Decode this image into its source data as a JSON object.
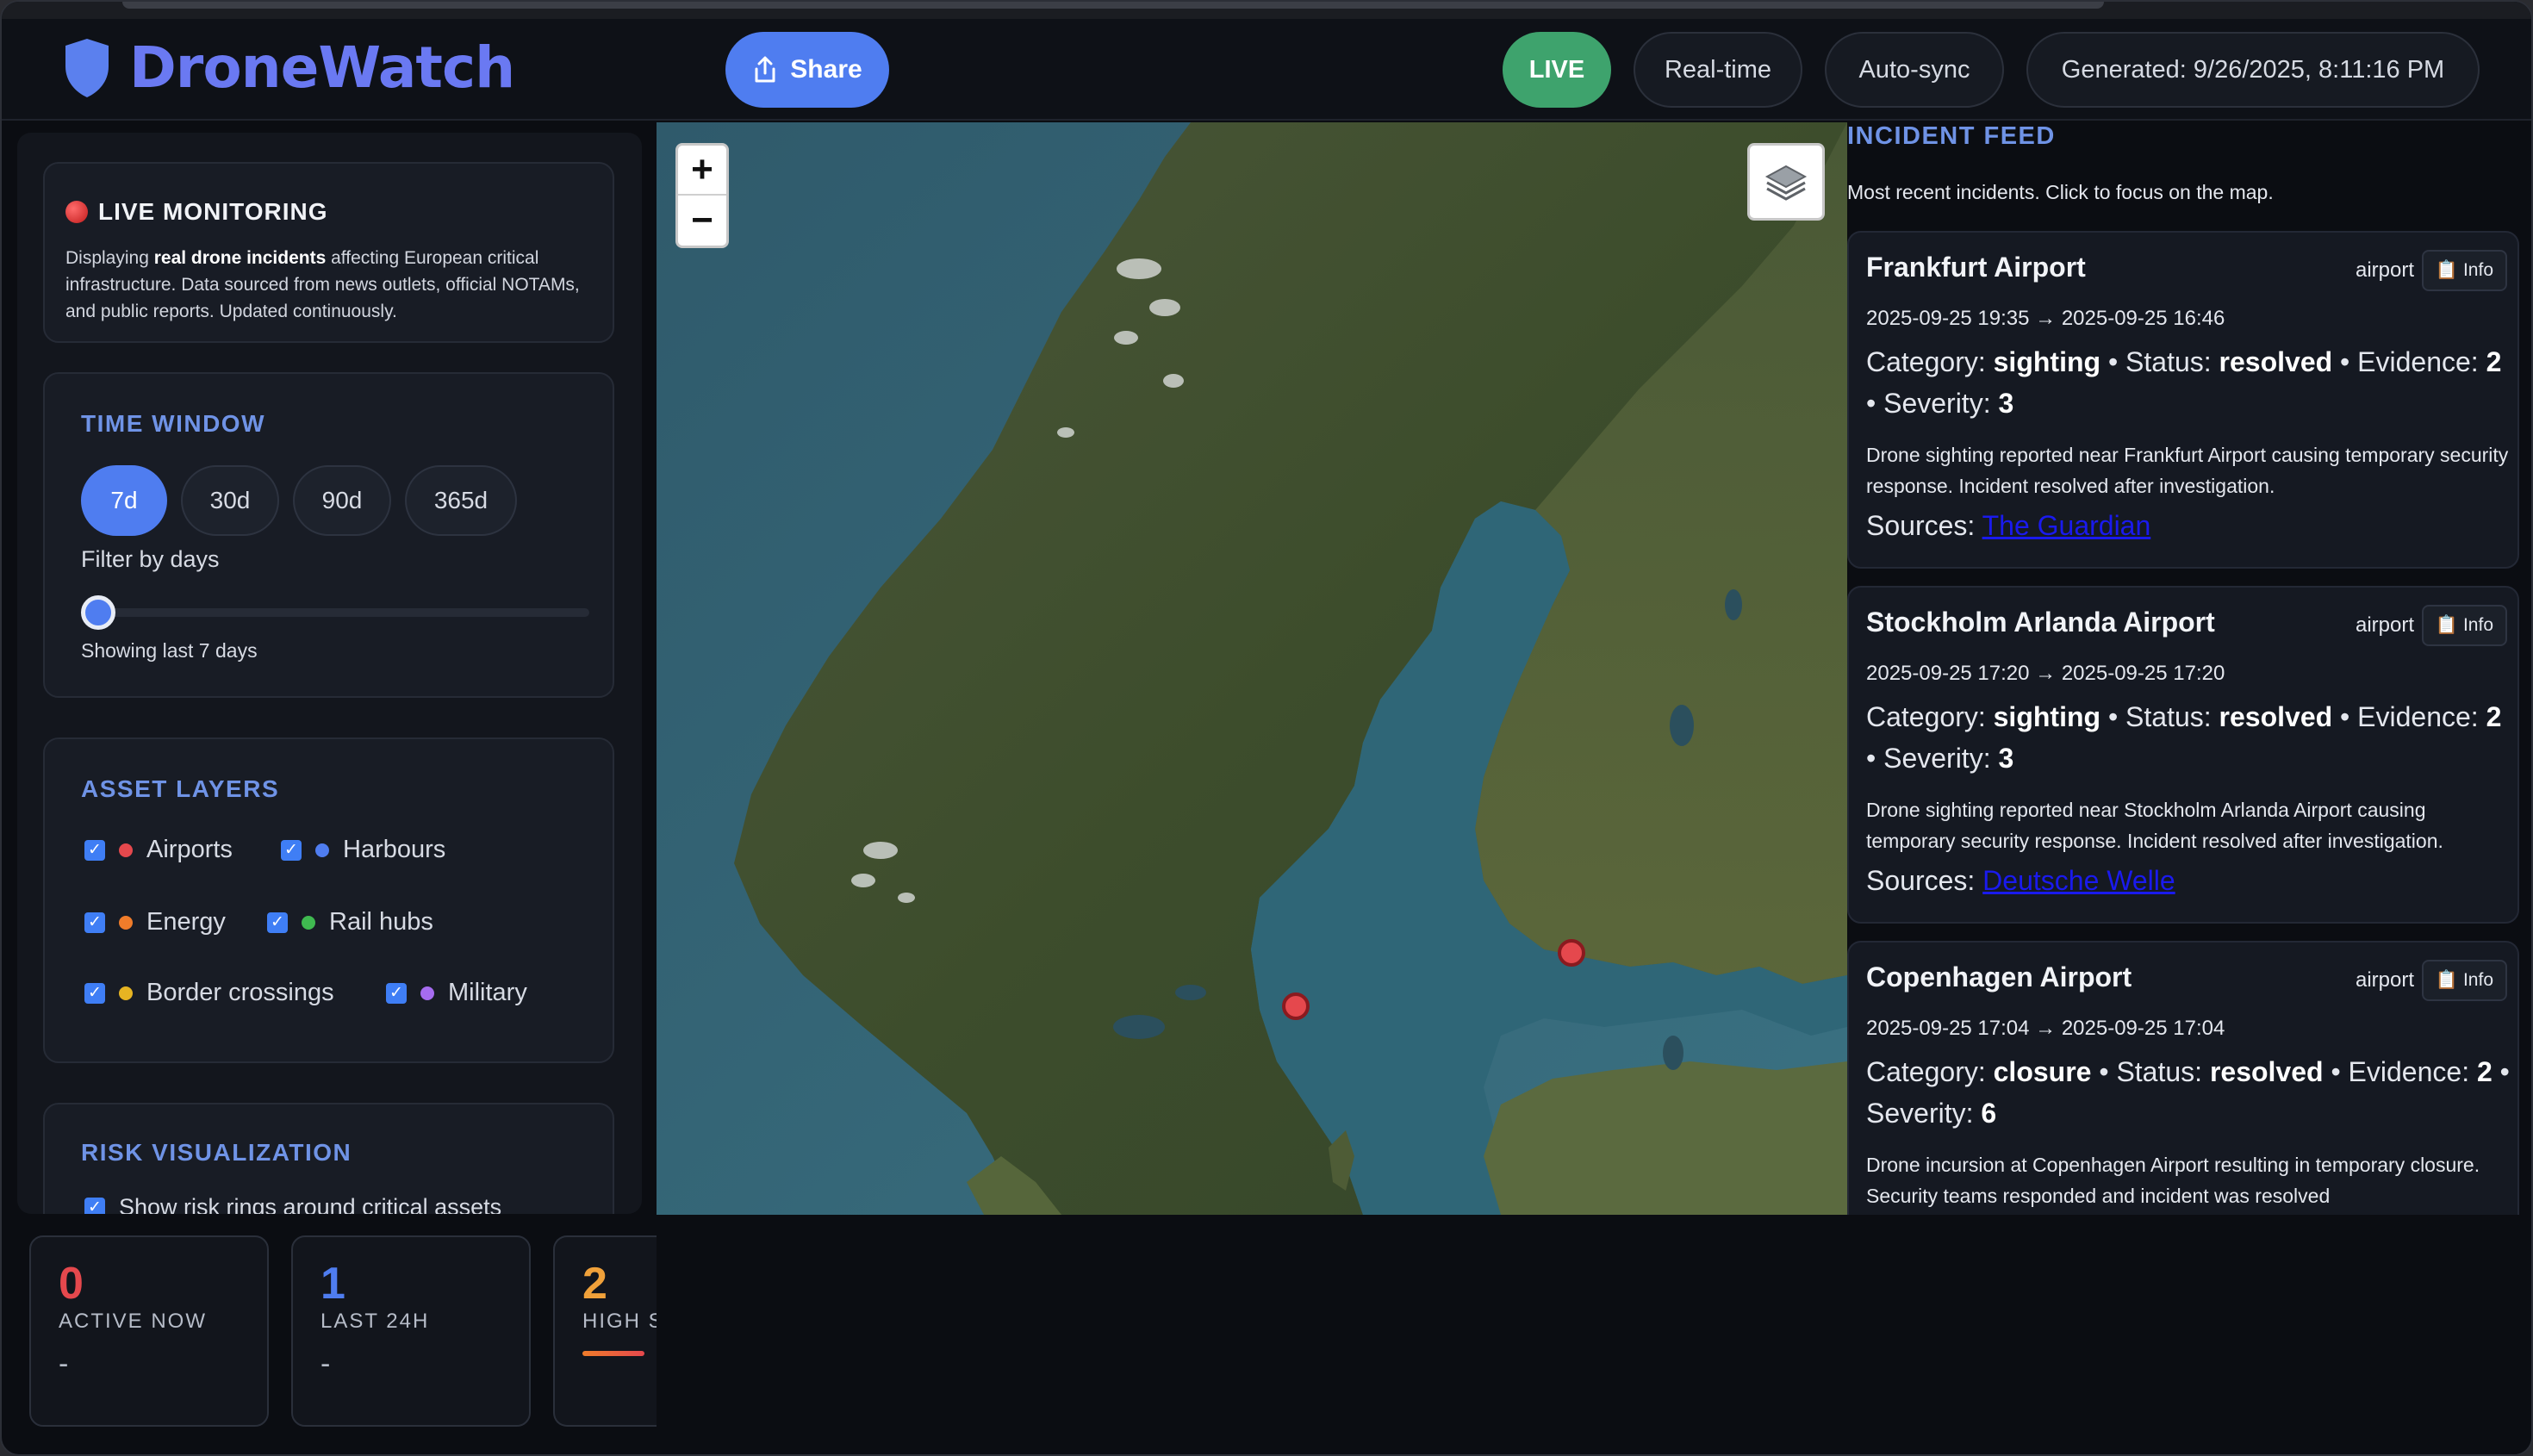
{
  "app": {
    "name": "DroneWatch"
  },
  "header": {
    "share_label": "Share",
    "live_label": "LIVE",
    "realtime_label": "Real-time",
    "autosync_label": "Auto-sync",
    "generated_label": "Generated: 9/26/2025, 8:11:16 PM"
  },
  "sidebar": {
    "live": {
      "title": "LIVE MONITORING",
      "desc_prefix": "Displaying ",
      "desc_bold": "real drone incidents",
      "desc_rest": " affecting European critical infrastructure. Data sourced from news outlets, official NOTAMs, and public reports. Updated continuously."
    },
    "time_window": {
      "title": "TIME WINDOW",
      "options": [
        "7d",
        "30d",
        "90d",
        "365d"
      ],
      "selected": "7d",
      "filter_label": "Filter by days",
      "slider_fraction": 0.0,
      "showing_text": "Showing last 7 days"
    },
    "asset_layers": {
      "title": "ASSET LAYERS",
      "items": [
        {
          "label": "Airports",
          "color": "#e5484d",
          "checked": true
        },
        {
          "label": "Harbours",
          "color": "#4f7df0",
          "checked": true
        },
        {
          "label": "Energy",
          "color": "#f07c2a",
          "checked": true
        },
        {
          "label": "Rail hubs",
          "color": "#3fb950",
          "checked": true
        },
        {
          "label": "Border crossings",
          "color": "#e6b422",
          "checked": true
        },
        {
          "label": "Military",
          "color": "#a66cf0",
          "checked": true
        }
      ]
    },
    "risk": {
      "title": "RISK VISUALIZATION",
      "ring_label": "Show risk rings around critical assets"
    }
  },
  "stats": [
    {
      "value": "0",
      "label": "ACTIVE NOW",
      "sub": "-",
      "color": "#e5484d"
    },
    {
      "value": "1",
      "label": "LAST 24H",
      "sub": "-",
      "color": "#4f7df0"
    },
    {
      "value": "2",
      "label": "HIGH S",
      "sub": "",
      "color": "#f0a13a"
    }
  ],
  "map": {
    "zoom_in": "+",
    "zoom_out": "−",
    "layers_icon": "layers-icon"
  },
  "feed": {
    "title": "INCIDENT FEED",
    "subtitle": "Most recent incidents. Click to focus on the map.",
    "info_label": "Info",
    "incidents": [
      {
        "name": "Frankfurt Airport",
        "type": "airport",
        "time": "2025-09-25 19:35 → 2025-09-25 16:46",
        "category": "sighting",
        "status": "resolved",
        "evidence": "2",
        "severity": "3",
        "desc": "Drone sighting reported near Frankfurt Airport causing temporary security response. Incident resolved after investigation.",
        "source": "The Guardian"
      },
      {
        "name": "Stockholm Arlanda Airport",
        "type": "airport",
        "time": "2025-09-25 17:20 → 2025-09-25 17:20",
        "category": "sighting",
        "status": "resolved",
        "evidence": "2",
        "severity": "3",
        "desc": "Drone sighting reported near Stockholm Arlanda Airport causing temporary security response. Incident resolved after investigation.",
        "source": "Deutsche Welle"
      },
      {
        "name": "Copenhagen Airport",
        "type": "airport",
        "time": "2025-09-25 17:04 → 2025-09-25 17:04",
        "category": "closure",
        "status": "resolved",
        "evidence": "2",
        "severity": "6",
        "desc": "Drone incursion at Copenhagen Airport resulting in temporary closure. Security teams responded and incident was resolved",
        "source": ""
      }
    ],
    "labels": {
      "category": "Category: ",
      "status": " • Status: ",
      "evidence": " • Evidence: ",
      "severity": " • Severity: ",
      "sources": "Sources: "
    }
  }
}
